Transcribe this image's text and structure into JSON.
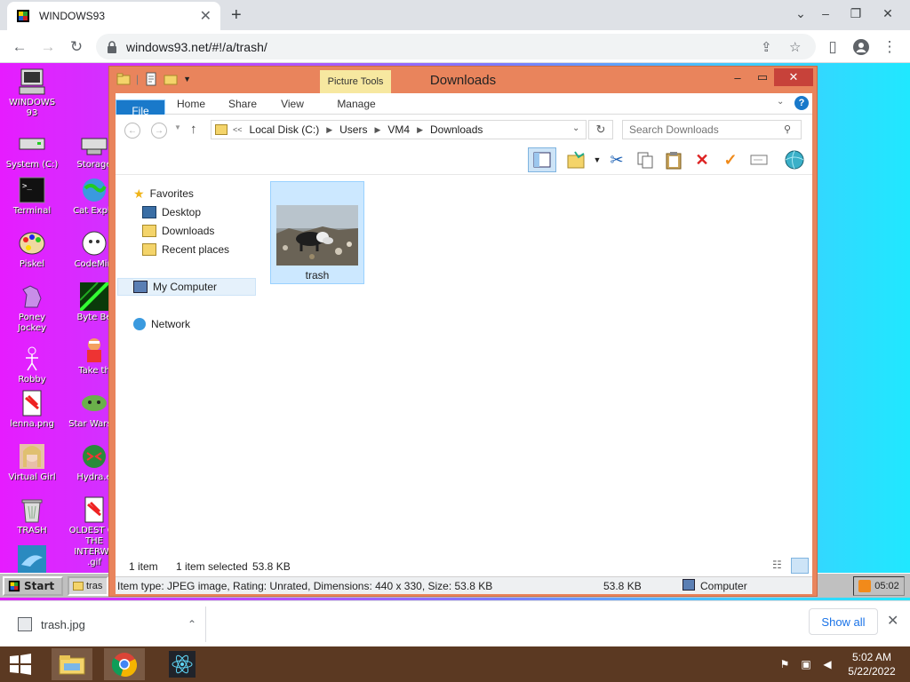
{
  "browser": {
    "tab_title": "WINDOWS93",
    "url": "windows93.net/#!/a/trash/",
    "new_tab_symbol": "+"
  },
  "desktop": {
    "icons": [
      {
        "label": "WINDOWS 93",
        "icon": "computer-icon"
      },
      {
        "label": "System (C:)",
        "icon": "drive-icon"
      },
      {
        "label": "Storage",
        "icon": "storage-icon"
      },
      {
        "label": "Terminal",
        "icon": "terminal-icon"
      },
      {
        "label": "Cat Explo",
        "icon": "cat-explorer-icon"
      },
      {
        "label": "Piskel",
        "icon": "paint-icon"
      },
      {
        "label": "CodeMirr",
        "icon": "codemirror-icon"
      },
      {
        "label": "Poney Jockey",
        "icon": "pony-icon"
      },
      {
        "label": "Byte Be",
        "icon": "bytebeat-icon"
      },
      {
        "label": "Robby",
        "icon": "robot-icon"
      },
      {
        "label": "Take th",
        "icon": "take-the-icon"
      },
      {
        "label": "lenna.png",
        "icon": "image-file-icon"
      },
      {
        "label": "Star Wars.a",
        "icon": "yoda-icon"
      },
      {
        "label": "Virtual Girl",
        "icon": "virtual-girl-icon"
      },
      {
        "label": "Hydra.e",
        "icon": "hydra-icon"
      },
      {
        "label": "TRASH",
        "icon": "trash-icon"
      },
      {
        "label": "OLDEST OF THE INTERWE .gif",
        "icon": "gif-file-icon"
      }
    ]
  },
  "explorer": {
    "title": "Downloads",
    "contextual_group": "Picture Tools",
    "ribbon_tabs": [
      "File",
      "Home",
      "Share",
      "View",
      "Manage"
    ],
    "address": {
      "overflow": "<<",
      "crumbs": [
        "Local Disk (C:)",
        "Users",
        "VM4",
        "Downloads"
      ]
    },
    "search_placeholder": "Search Downloads",
    "nav": {
      "favorites": "Favorites",
      "fav_items": [
        "Desktop",
        "Downloads",
        "Recent places"
      ],
      "computer": "My Computer",
      "network": "Network"
    },
    "files": [
      {
        "name": "trash",
        "type": "jpeg-thumbnail"
      }
    ],
    "status": {
      "count": "1 item",
      "selected": "1 item selected",
      "size": "53.8 KB"
    },
    "details_bar": {
      "info": "Item type: JPEG image, Rating: Unrated, Dimensions: 440 x 330, Size: 53.8 KB",
      "size": "53.8 KB",
      "location": "Computer"
    }
  },
  "w93_taskbar": {
    "start": "Start",
    "task": "tras",
    "clock": "05:02"
  },
  "downloads_bar": {
    "file": "trash.jpg",
    "show_all": "Show all"
  },
  "os_taskbar": {
    "time": "5:02 AM",
    "date": "5/22/2022"
  },
  "colors": {
    "window_frame": "#e9845c",
    "file_tab": "#1979ca",
    "selection": "#cce8ff",
    "os_taskbar": "#5b3922"
  }
}
